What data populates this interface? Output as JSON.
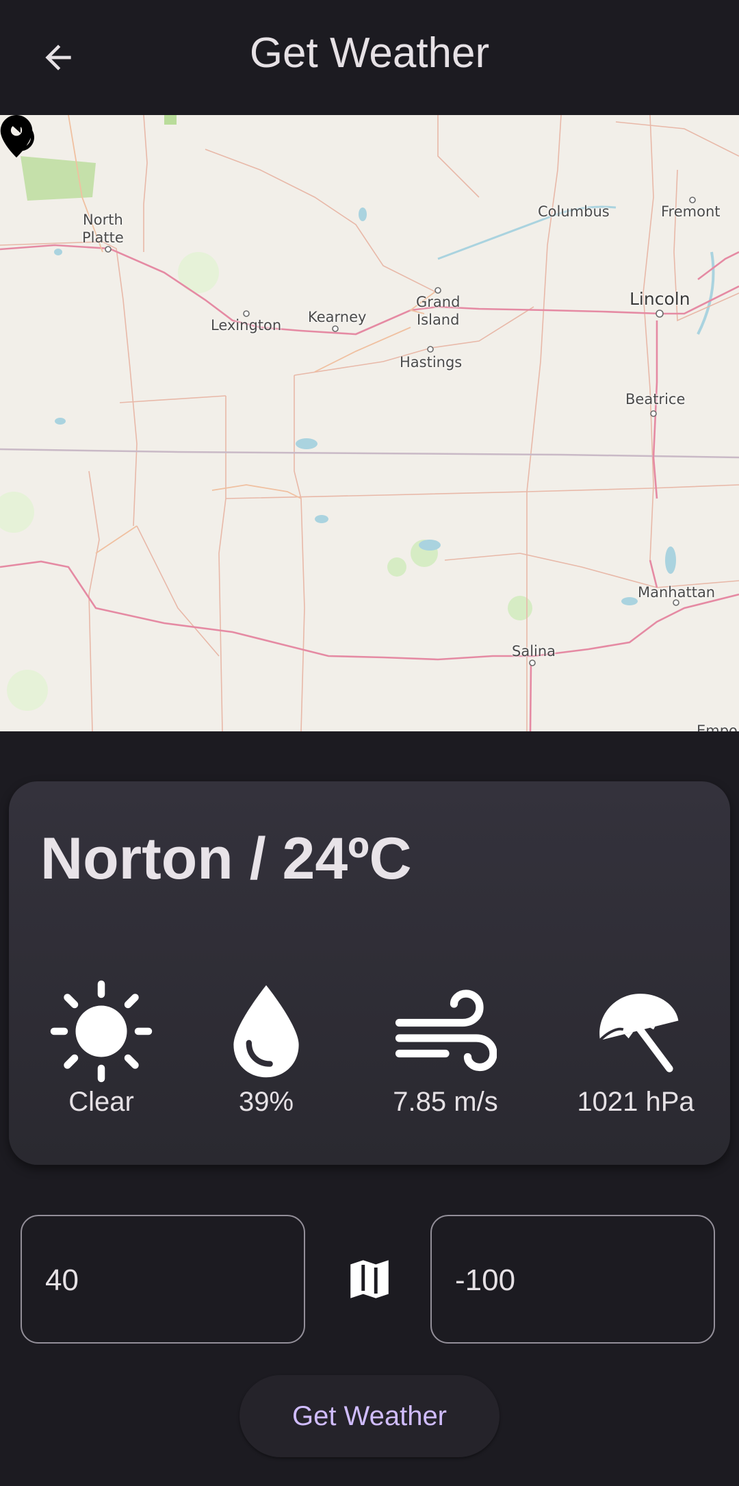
{
  "appbar": {
    "title": "Get Weather",
    "back_icon": "arrow-left-icon"
  },
  "map": {
    "labels": {
      "north_platte": "North\nPlatte",
      "columbus": "Columbus",
      "fremont": "Fremont",
      "lexington": "Lexington",
      "kearney": "Kearney",
      "grand_island": "Grand\nIsland",
      "lincoln": "Lincoln",
      "hastings": "Hastings",
      "beatrice": "Beatrice",
      "manhattan": "Manhattan",
      "salina": "Salina",
      "emporia": "Empo"
    },
    "marker_icon": "location-pin-icon",
    "reset_icon": "rotate-reset-icon"
  },
  "weather": {
    "title": "Norton / 24ºC",
    "condition": {
      "label": "Clear",
      "icon": "sun-icon"
    },
    "humidity": {
      "label": "39%",
      "icon": "water-drop-icon"
    },
    "wind": {
      "label": "7.85 m/s",
      "icon": "wind-icon"
    },
    "pressure": {
      "label": "1021 hPa",
      "icon": "umbrella-icon"
    }
  },
  "inputs": {
    "latitude": "40",
    "longitude": "-100",
    "map_toggle_icon": "map-icon"
  },
  "button": {
    "label": "Get Weather"
  },
  "colors": {
    "background": "#1c1b21",
    "card": "#2f2d36",
    "accent": "#d0bcff",
    "map_land": "#f2efe9",
    "map_road": "#e8829a"
  }
}
